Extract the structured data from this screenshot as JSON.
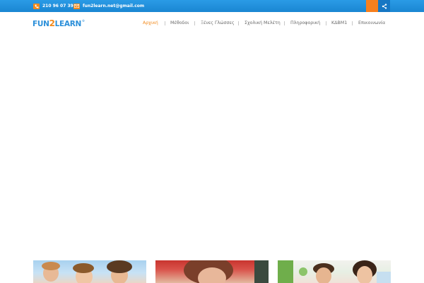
{
  "topbar": {
    "phone": "210 96 07 398",
    "email": "fun2learn.net@gmail.com",
    "phone_icon": "phone-icon",
    "email_icon": "envelope-icon",
    "share_icon": "share-icon",
    "bar_color": "#1e8fdc",
    "accent_color": "#f7801e"
  },
  "brand": {
    "part1": "FUN",
    "part2": "2",
    "part3": "LEARN",
    "reg": "®"
  },
  "nav": [
    {
      "label": "Αρχική",
      "active": true
    },
    {
      "label": "Μέθοδοι",
      "active": false
    },
    {
      "label": "Ξένες Γλώσσες",
      "active": false
    },
    {
      "label": "Σχολική Μελέτη",
      "active": false
    },
    {
      "label": "Πληροφορική",
      "active": false
    },
    {
      "label": "ΚΔΒΜ1",
      "active": false
    },
    {
      "label": "Επικοινωνία",
      "active": false
    }
  ],
  "colors": {
    "brand_blue": "#2b8fd9",
    "brand_orange": "#f28a1c",
    "nav_text": "#6a6a6a"
  }
}
